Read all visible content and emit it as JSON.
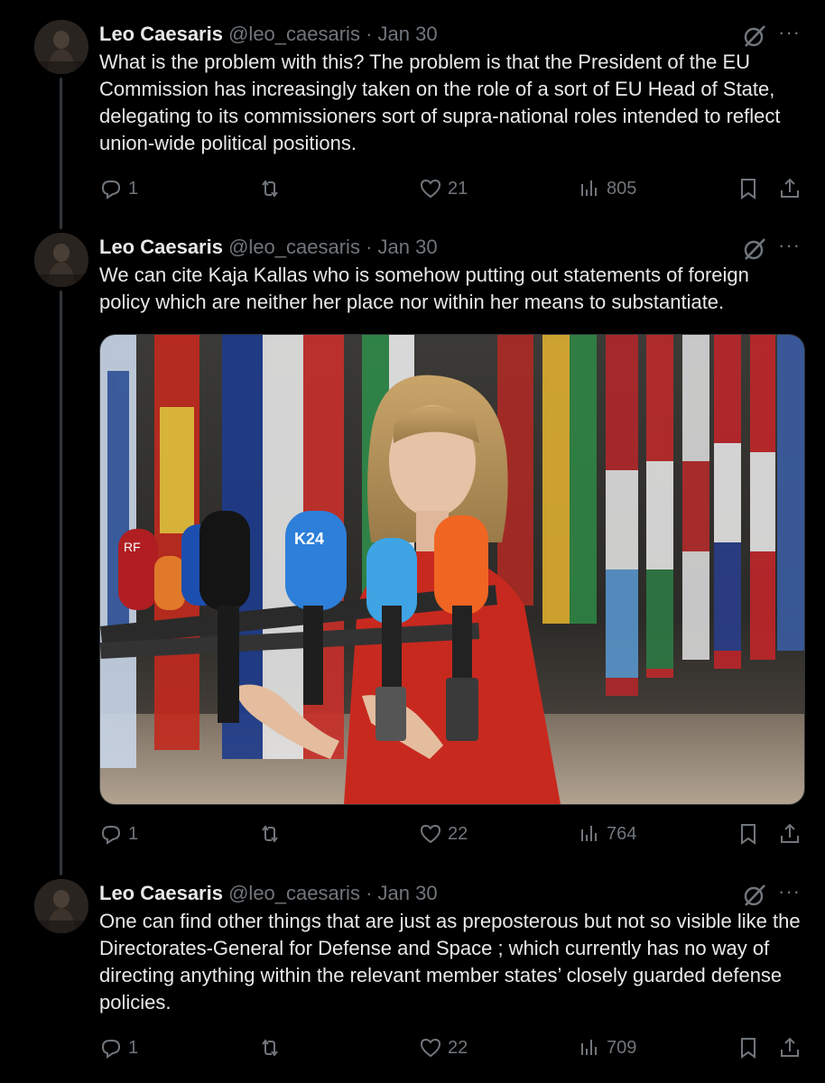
{
  "tweets": [
    {
      "name": "Leo Caesaris",
      "handle": "@leo_caesaris",
      "sep": "·",
      "date": "Jan 30",
      "text": "What is the problem with this? The problem is that the President of the EU Commission has increasingly taken on the role of a sort of EU Head of State, delegating to its commissioners sort of supra-national roles intended to reflect union-wide political positions.",
      "replies": "1",
      "retweets": "",
      "likes": "21",
      "views": "805"
    },
    {
      "name": "Leo Caesaris",
      "handle": "@leo_caesaris",
      "sep": "·",
      "date": "Jan 30",
      "text": "We can cite Kaja Kallas who is somehow putting out statements of foreign policy which are neither her place nor within her means to substantiate.",
      "replies": "1",
      "retweets": "",
      "likes": "22",
      "views": "764",
      "media_mic_labels": [
        "RF",
        "K24"
      ]
    },
    {
      "name": "Leo Caesaris",
      "handle": "@leo_caesaris",
      "sep": "·",
      "date": "Jan 30",
      "text": "One can find other things that are just as preposterous but not so visible like the Directorates-General for Defense and Space ; which currently has no way of directing anything within the relevant member states’ closely guarded defense policies.",
      "replies": "1",
      "retweets": "",
      "likes": "22",
      "views": "709"
    }
  ],
  "icons": {
    "reply": "reply-icon",
    "retweet": "retweet-icon",
    "like": "heart-icon",
    "views": "views-chart-icon",
    "bookmark": "bookmark-icon",
    "share": "share-icon",
    "grok": "grok-icon",
    "more": "more-icon"
  },
  "more_glyph": "···",
  "colors": {
    "background": "#000000",
    "text": "#e7e9ea",
    "secondary": "#71767b"
  }
}
